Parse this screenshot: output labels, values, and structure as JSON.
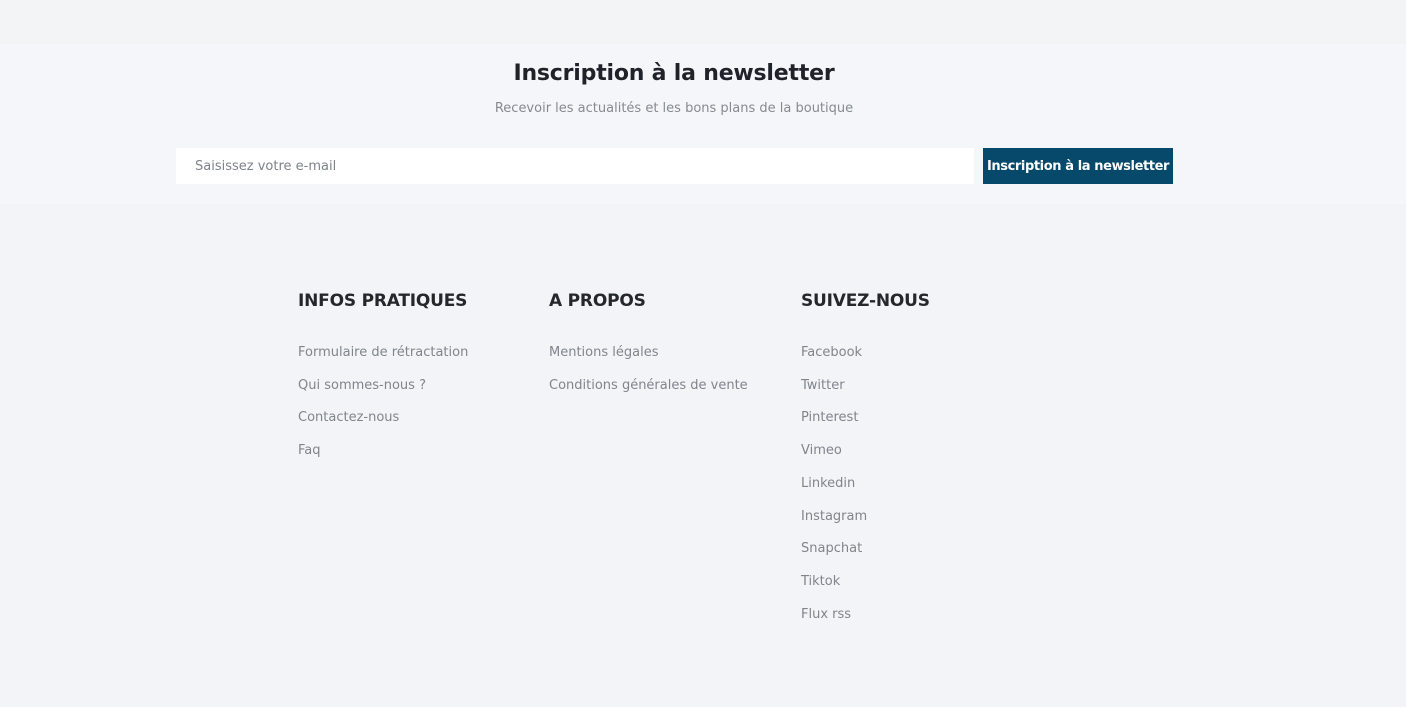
{
  "newsletter": {
    "title": "Inscription à la newsletter",
    "subtitle": "Recevoir les actualités et les bons plans de la boutique",
    "email_placeholder": "Saisissez votre e-mail",
    "button_label": "Inscription à la newsletter"
  },
  "footer": {
    "columns": [
      {
        "title": "INFOS PRATIQUES",
        "links": [
          "Formulaire de rétractation",
          "Qui sommes-nous ?",
          "Contactez-nous",
          "Faq"
        ]
      },
      {
        "title": "A PROPOS",
        "links": [
          "Mentions légales",
          "Conditions générales de vente"
        ]
      },
      {
        "title": "SUIVEZ-NOUS",
        "links": [
          "Facebook",
          "Twitter",
          "Pinterest",
          "Vimeo",
          "Linkedin",
          "Instagram",
          "Snapchat",
          "Tiktok",
          "Flux rss"
        ]
      }
    ]
  },
  "colors": {
    "background": "#f2f4f7",
    "accent": "#06496b",
    "link": "#80858c",
    "heading": "#24272c"
  }
}
